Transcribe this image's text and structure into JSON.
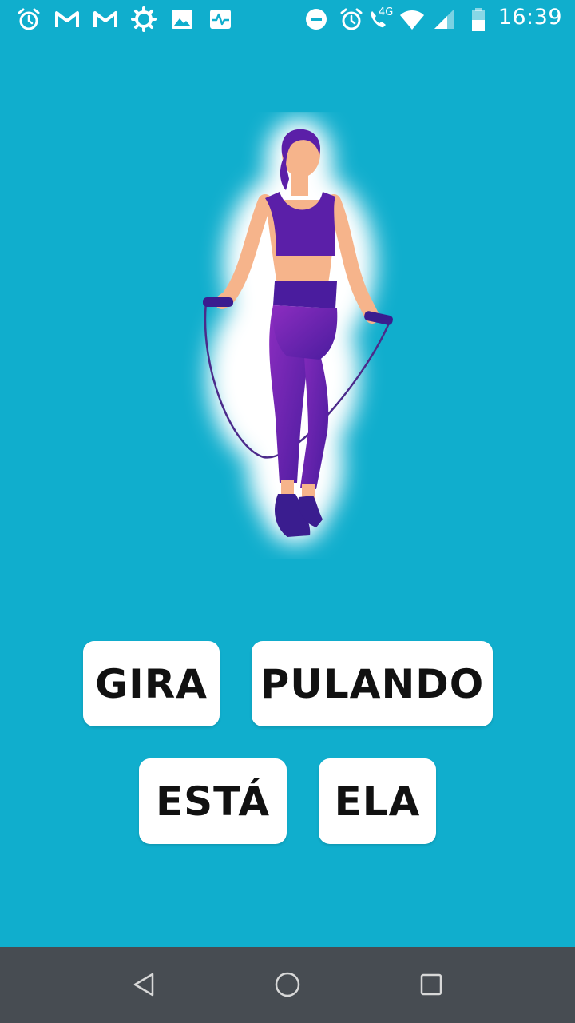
{
  "status_bar": {
    "time": "16:39",
    "network_label": "4G",
    "left_icons": [
      "alarm-icon",
      "gmail-icon",
      "gmail-icon",
      "settings-icon",
      "gallery-icon",
      "health-icon"
    ],
    "right_icons": [
      "do-not-disturb-icon",
      "alarm-icon",
      "wifi-calling-icon",
      "wifi-icon",
      "signal-icon",
      "battery-icon"
    ]
  },
  "illustration": {
    "subject": "woman-jumping-rope-icon"
  },
  "word_tiles": [
    {
      "label": "GIRA"
    },
    {
      "label": "PULANDO"
    },
    {
      "label": "ESTÁ"
    },
    {
      "label": "ELA"
    }
  ],
  "nav_bar": {
    "buttons": [
      "back-icon",
      "home-icon",
      "recents-icon"
    ]
  },
  "colors": {
    "background": "#10aecd",
    "tile": "#ffffff",
    "nav_bar": "#474c52",
    "outfit": "#5b1fa8"
  }
}
